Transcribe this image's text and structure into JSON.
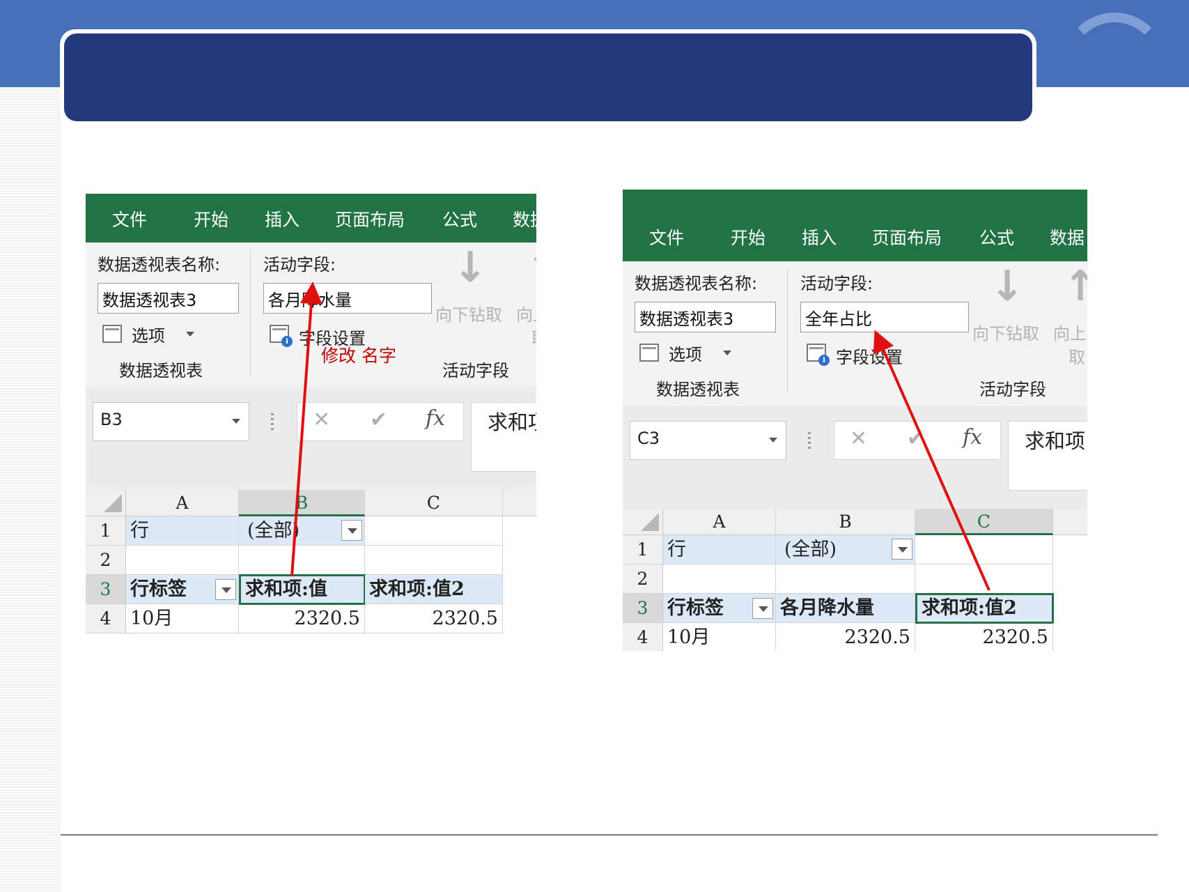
{
  "left": {
    "tabs": [
      "文件",
      "开始",
      "插入",
      "页面布局",
      "公式",
      "数据"
    ],
    "pivot_name_label": "数据透视表名称:",
    "pivot_name_value": "数据透视表3",
    "options_label": "选项",
    "group_pivot": "数据透视表",
    "active_field_label": "活动字段:",
    "active_field_value": "各月降水量",
    "field_settings": "字段设置",
    "drill_down": "向下钻取",
    "drill_up_1": "向上",
    "drill_up_2": "取",
    "group_active": "活动字段",
    "annotation": "修改  名字",
    "name_box": "B3",
    "formula_text": "求和项",
    "columns": [
      "A",
      "B",
      "C"
    ],
    "rows": [
      {
        "num": "1",
        "a": "行",
        "b": "(全部)",
        "c": ""
      },
      {
        "num": "2",
        "a": "",
        "b": "",
        "c": ""
      },
      {
        "num": "3",
        "a": "行标签",
        "b": "求和项:值",
        "c": "求和项:值2"
      },
      {
        "num": "4",
        "a": "10月",
        "b": "2320.5",
        "c": "2320.5"
      }
    ]
  },
  "right": {
    "tabs": [
      "文件",
      "开始",
      "插入",
      "页面布局",
      "公式",
      "数据"
    ],
    "pivot_name_label": "数据透视表名称:",
    "pivot_name_value": "数据透视表3",
    "options_label": "选项",
    "group_pivot": "数据透视表",
    "active_field_label": "活动字段:",
    "active_field_value": "全年占比",
    "field_settings": "字段设置",
    "drill_down": "向下钻取",
    "drill_up_1": "向上",
    "drill_up_2": "取",
    "group_active": "活动字段",
    "name_box": "C3",
    "formula_text": "求和项",
    "columns": [
      "A",
      "B",
      "C"
    ],
    "rows": [
      {
        "num": "1",
        "a": "行",
        "b": "(全部)",
        "c": ""
      },
      {
        "num": "2",
        "a": "",
        "b": "",
        "c": ""
      },
      {
        "num": "3",
        "a": "行标签",
        "b": "各月降水量",
        "c": "求和项:值2"
      },
      {
        "num": "4",
        "a": "10月",
        "b": "2320.5",
        "c": "2320.5"
      }
    ]
  },
  "colors": {
    "excel_green": "#217346",
    "header_blue": "#4670b9",
    "title_navy": "#24387c",
    "arrow_red": "#e01010"
  }
}
